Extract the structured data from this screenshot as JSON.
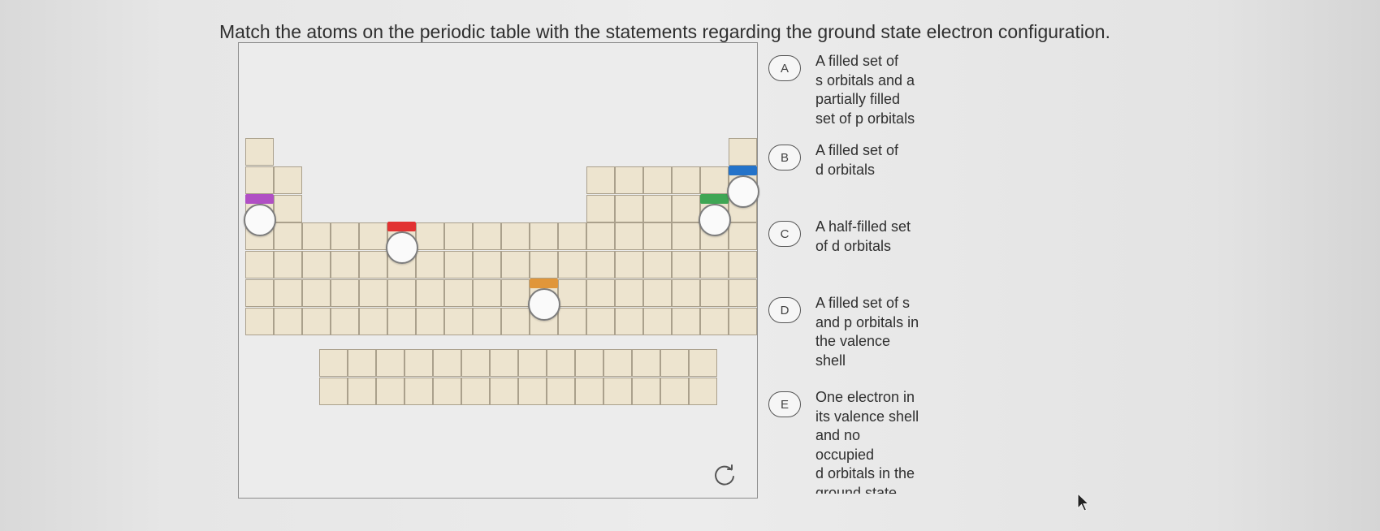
{
  "question": "Match the atoms on the periodic table with the statements regarding the ground state electron configuration.",
  "periodic_table": {
    "markers": [
      {
        "label": "purple-marker",
        "color": "#b04fc4"
      },
      {
        "label": "red-marker",
        "color": "#e23131"
      },
      {
        "label": "orange-marker",
        "color": "#e0963a"
      },
      {
        "label": "green-marker",
        "color": "#3fa654"
      },
      {
        "label": "blue-marker",
        "color": "#2473c9"
      }
    ],
    "reset_icon": "reset-icon"
  },
  "options": [
    {
      "letter": "A",
      "lines": [
        "A filled set of",
        "s orbitals and a",
        "partially filled",
        "set of p orbitals"
      ]
    },
    {
      "letter": "B",
      "lines": [
        "A filled set of",
        "d orbitals"
      ]
    },
    {
      "letter": "C",
      "lines": [
        "A half-filled set",
        "of d orbitals"
      ]
    },
    {
      "letter": "D",
      "lines": [
        "A filled set of s",
        "and p orbitals in",
        "the valence",
        "shell"
      ]
    },
    {
      "letter": "E",
      "lines": [
        "One electron in",
        "its valence shell",
        "and no",
        "occupied",
        "d orbitals in the",
        "ground state"
      ]
    }
  ]
}
